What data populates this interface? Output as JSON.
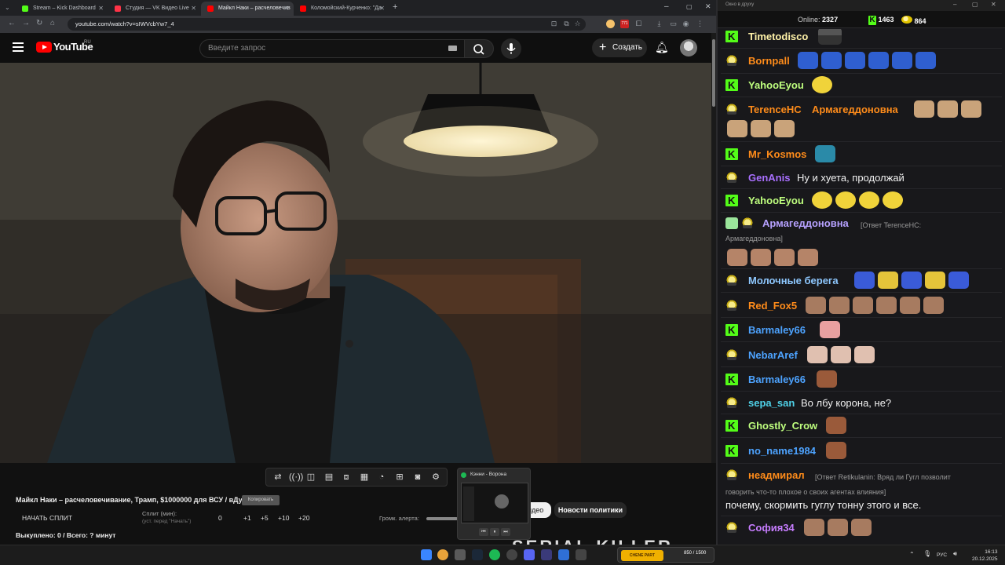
{
  "browser": {
    "tabs": [
      {
        "label": "Stream – Kick Dashboard",
        "color": "#53fc18"
      },
      {
        "label": "Студия — VK Видео Live",
        "color": "#ff3347"
      },
      {
        "label": "Майкл Наки – расчеловечив",
        "color": "#ff0000"
      },
      {
        "label": "Коломойский-Курченко: \"Да",
        "color": "#ff0000"
      }
    ],
    "url": "youtube.com/watch?v=sIWVcbYw7_4",
    "extension_badge": "771"
  },
  "youtube": {
    "logo_text": "YouTube",
    "region": "RU",
    "search_placeholder": "Введите запрос",
    "create_label": "Создать",
    "chips": {
      "video": "идео",
      "policy": "Новости политики"
    },
    "banner_text": "SERIAL KILLER"
  },
  "overlay": {
    "video_title": "Майкл Наки – расчеловечивание, Трамп, $1000000 для ВСУ / вДудь",
    "copy_button": "Копировать",
    "start_split": "НАЧАТЬ СПЛИТ",
    "split_label": "Сплит (мин):",
    "split_sub": "(уст. перед \"Начать\")",
    "split_values": [
      "0",
      "+1",
      "+5",
      "+10",
      "+20"
    ],
    "alert_label": "Громк. алерта:",
    "bought": "Выкуплено: 0 / Всего: ? минут"
  },
  "mini_player": {
    "title": "Кэнни - Ворона"
  },
  "chat": {
    "window_title": "Окно в друху",
    "online_label": "Online:",
    "online_count": "2327",
    "kick_count": "1463",
    "twitch_count": "864",
    "messages": [
      {
        "badge": "k",
        "user": "Timetodisco",
        "color": "#fff2a8",
        "text": ""
      },
      {
        "badge": "t",
        "user": "Bornpall",
        "color": "#ff8c1a",
        "text": ""
      },
      {
        "badge": "k",
        "user": "YahooEyou",
        "color": "#bfff7f",
        "text": ""
      },
      {
        "badge": "t",
        "user": "TerenceHC",
        "color": "#ff8c1a",
        "text": "Армагеддоновна"
      },
      {
        "badge": "k",
        "user": "Mr_Kosmos",
        "color": "#ff8c1a",
        "text": ""
      },
      {
        "badge": "t",
        "user": "GenAnis",
        "color": "#a970ff",
        "text": "Ну и хуета, продолжай"
      },
      {
        "badge": "k",
        "user": "YahooEyou",
        "color": "#bfff7f",
        "text": ""
      },
      {
        "badge": "t",
        "user": "Армагеддоновна",
        "color": "#b6a1ff",
        "text": "[Ответ TerenceHC:",
        "text2": "Армагеддоновна]"
      },
      {
        "badge": "t",
        "user": "Молочные берега",
        "color": "#8ec8ff",
        "text": ""
      },
      {
        "badge": "t",
        "user": "Red_Fox5",
        "color": "#ff8c1a",
        "text": ""
      },
      {
        "badge": "k",
        "user": "Barmaley66",
        "color": "#4da3ff",
        "text": ""
      },
      {
        "badge": "t",
        "user": "NebarAref",
        "color": "#4da3ff",
        "text": ""
      },
      {
        "badge": "k",
        "user": "Barmaley66",
        "color": "#4da3ff",
        "text": ""
      },
      {
        "badge": "t",
        "user": "sepa_san",
        "color": "#4fd1e8",
        "text": "Во лбу корона, не?"
      },
      {
        "badge": "k",
        "user": "Ghostly_Crow",
        "color": "#bfff7f",
        "text": ""
      },
      {
        "badge": "k",
        "user": "no_name1984",
        "color": "#4da3ff",
        "text": ""
      },
      {
        "badge": "t",
        "user": "неадмирал",
        "color": "#ff8c1a",
        "text": "[Ответ Retikulanin: Вряд ли Гугл позволит",
        "text2": "говорить что-то плохое о своих агентах влияния]",
        "text3": "почему, скормить гуглу тонну этого и все."
      },
      {
        "badge": "t",
        "user": "София34",
        "color": "#c77dff",
        "text": ""
      }
    ]
  },
  "taskbar": {
    "widget_label": "CHENE PART",
    "widget_count": "850 / 1500",
    "lang": "РУС",
    "time": "16:13",
    "date": "20.12.2025"
  },
  "colors": {
    "kick_green": "#53fc18",
    "youtube_red": "#ff0000"
  }
}
